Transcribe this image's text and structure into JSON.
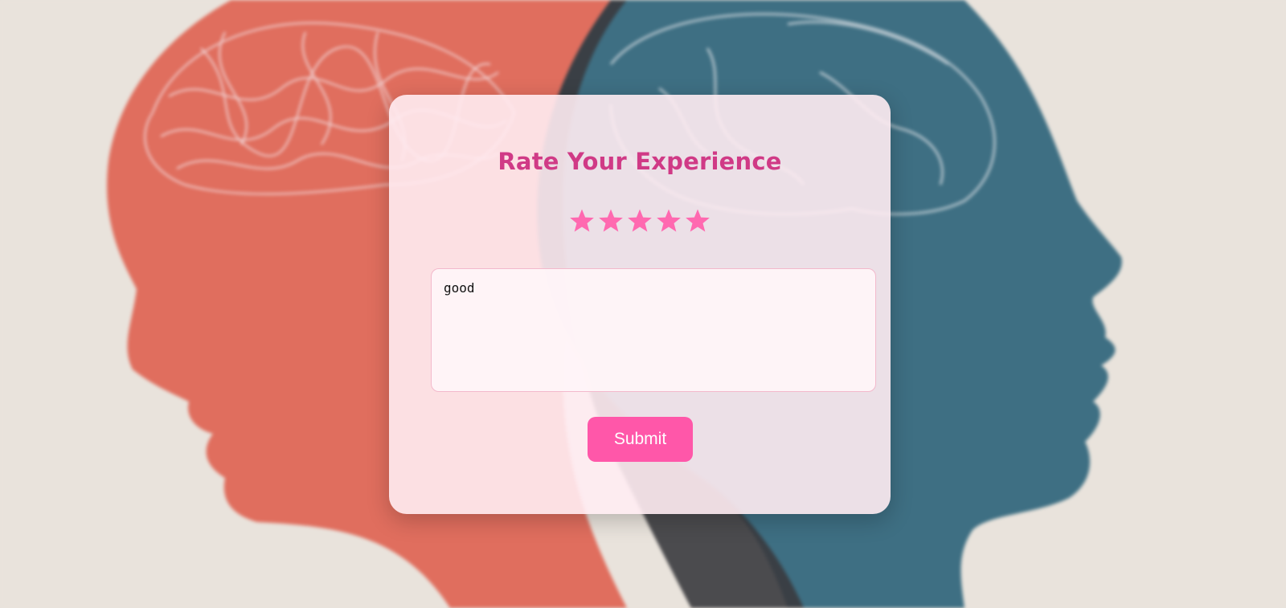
{
  "page": {
    "title": "Rate Your Experience"
  },
  "rating": {
    "value": 5,
    "max": 5,
    "star_glyph": "star-icon",
    "color": "#ff69b0"
  },
  "feedback": {
    "value": "good"
  },
  "actions": {
    "submit_label": "Submit"
  },
  "colors": {
    "title": "#d03a86",
    "button": "#ff57a9",
    "left_head": "#e06e5e",
    "right_head": "#3e6f83",
    "background": "#e9e3dc"
  }
}
